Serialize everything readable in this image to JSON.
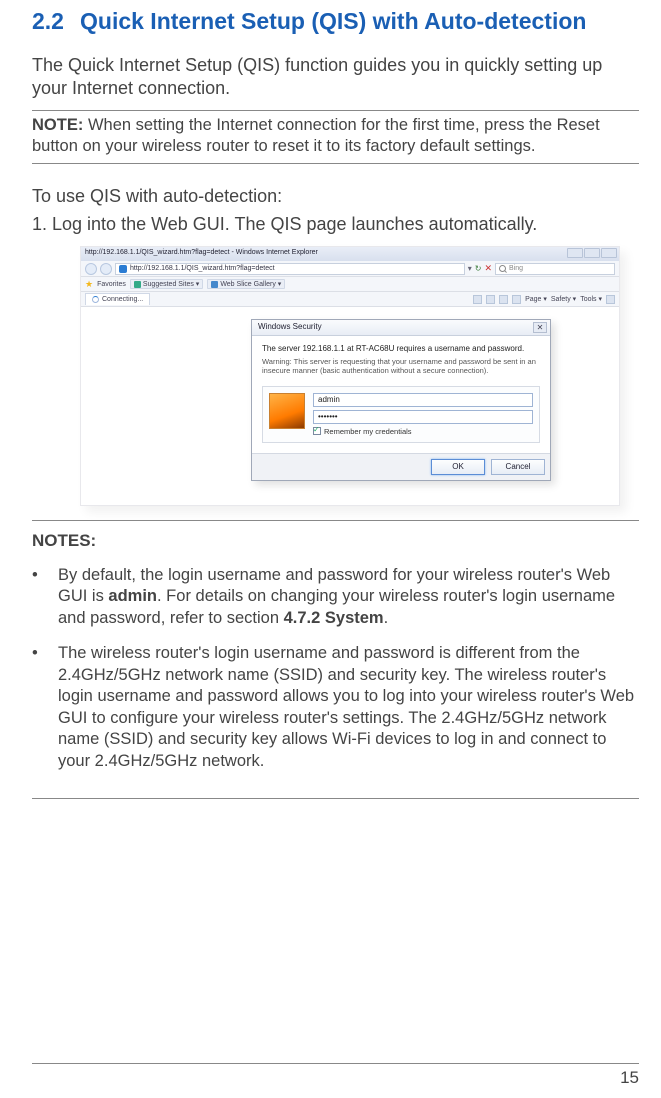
{
  "heading": {
    "number": "2.2",
    "title": "Quick Internet Setup (QIS) with Auto-detection"
  },
  "intro": "The Quick Internet Setup (QIS) function guides you in quickly setting up your Internet connection.",
  "note1": {
    "label": "NOTE:",
    "text": "When setting the Internet connection for the first time, press the Reset button on your wireless router to reset it to its factory default settings."
  },
  "subheading": "To use QIS with auto-detection:",
  "step1": "1.  Log into the Web GUI. The QIS page launches automatically.",
  "browser": {
    "titlebar": "http://192.168.1.1/QIS_wizard.htm?flag=detect - Windows Internet Explorer",
    "url": "http://192.168.1.1/QIS_wizard.htm?flag=detect",
    "search_placeholder": "Bing",
    "favorites_label": "Favorites",
    "suggested": "Suggested Sites ▾",
    "gallery": "Web Slice Gallery ▾",
    "tab_label": "Connecting...",
    "tools": {
      "page": "Page ▾",
      "safety": "Safety ▾",
      "tools": "Tools ▾"
    }
  },
  "dialog": {
    "title": "Windows Security",
    "message": "The server 192.168.1.1 at RT-AC68U requires a username and password.",
    "warning": "Warning: This server is requesting that your username and password be sent in an insecure manner (basic authentication without a secure connection).",
    "username": "admin",
    "password": "•••••••",
    "remember": "Remember my credentials",
    "ok": "OK",
    "cancel": "Cancel"
  },
  "notes": {
    "title": "NOTES:",
    "b1_pre": "By default, the login username and password for your wireless router's Web GUI is ",
    "b1_bold1": "admin",
    "b1_mid": ". For details on changing your wireless router's login username and password, refer to section ",
    "b1_bold2": "4.7.2 System",
    "b1_post": ".",
    "b2": "The wireless router's login username and password is different from the 2.4GHz/5GHz network name (SSID) and security key. The wireless router's login username and password allows you to log into your wireless router's Web GUI to configure your wireless router's settings. The 2.4GHz/5GHz network name (SSID) and security key allows Wi-Fi devices to log in and connect to your 2.4GHz/5GHz network."
  },
  "page_number": "15"
}
